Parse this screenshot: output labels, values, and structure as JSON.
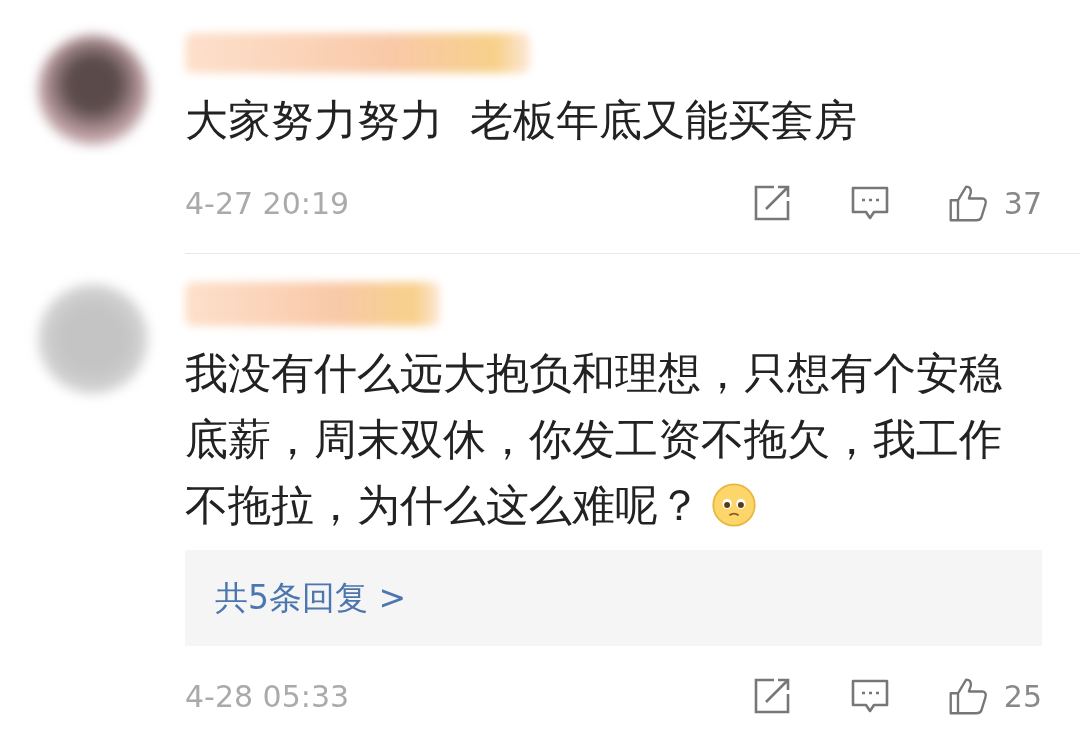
{
  "comments": [
    {
      "text": "大家努力努力  老板年底又能买套房",
      "time": "4-27 20:19",
      "likes": "37"
    },
    {
      "text": "我没有什么远大抱负和理想，只想有个安稳底薪，周末双休，你发工资不拖欠，我工作不拖拉，为什么这么难呢？",
      "emoji": true,
      "replies": "共5条回复 >",
      "time": "4-28 05:33",
      "likes": "25"
    }
  ]
}
